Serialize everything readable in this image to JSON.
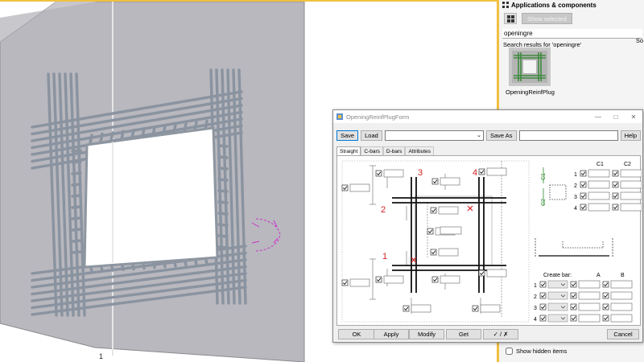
{
  "viewport": {
    "view_marker": "1"
  },
  "apps_panel": {
    "header": "Applications & components",
    "show_selected_label": "Show selected",
    "search_value": "openingre",
    "results_label": "Search results for 'openingre'",
    "results_sort_label": "So",
    "component_name": "OpeningReinfPlug",
    "show_hidden_label": "Show hidden items"
  },
  "dialog": {
    "title": "OpeningReinfPlugForm",
    "save_label": "Save",
    "load_label": "Load",
    "save_as_label": "Save As",
    "help_label": "Help",
    "tabs": [
      "Straight",
      "C-bars",
      "D-bars",
      "Attributes"
    ],
    "bar_numbers": [
      "1",
      "2",
      "3",
      "4"
    ],
    "c_headers": [
      "C1",
      "C2"
    ],
    "c_dim_labels": [
      "C1",
      "C2"
    ],
    "row_numbers": [
      "1",
      "2",
      "3",
      "4"
    ],
    "create_bar_label": "Create bar:",
    "a_label": "A",
    "b_label": "B",
    "ok_label": "OK",
    "apply_label": "Apply",
    "modify_label": "Modify",
    "get_label": "Get",
    "toggle_label": "✓ / ✗",
    "cancel_label": "Cancel"
  },
  "colors": {
    "accent_yellow": "#f0c040",
    "wall_gray": "#b7b7bd",
    "rebar_gray": "#8d96a0",
    "bar_number_red": "#d42020",
    "dimension_green": "#2e8b2e",
    "focus_blue": "#0078d7"
  }
}
